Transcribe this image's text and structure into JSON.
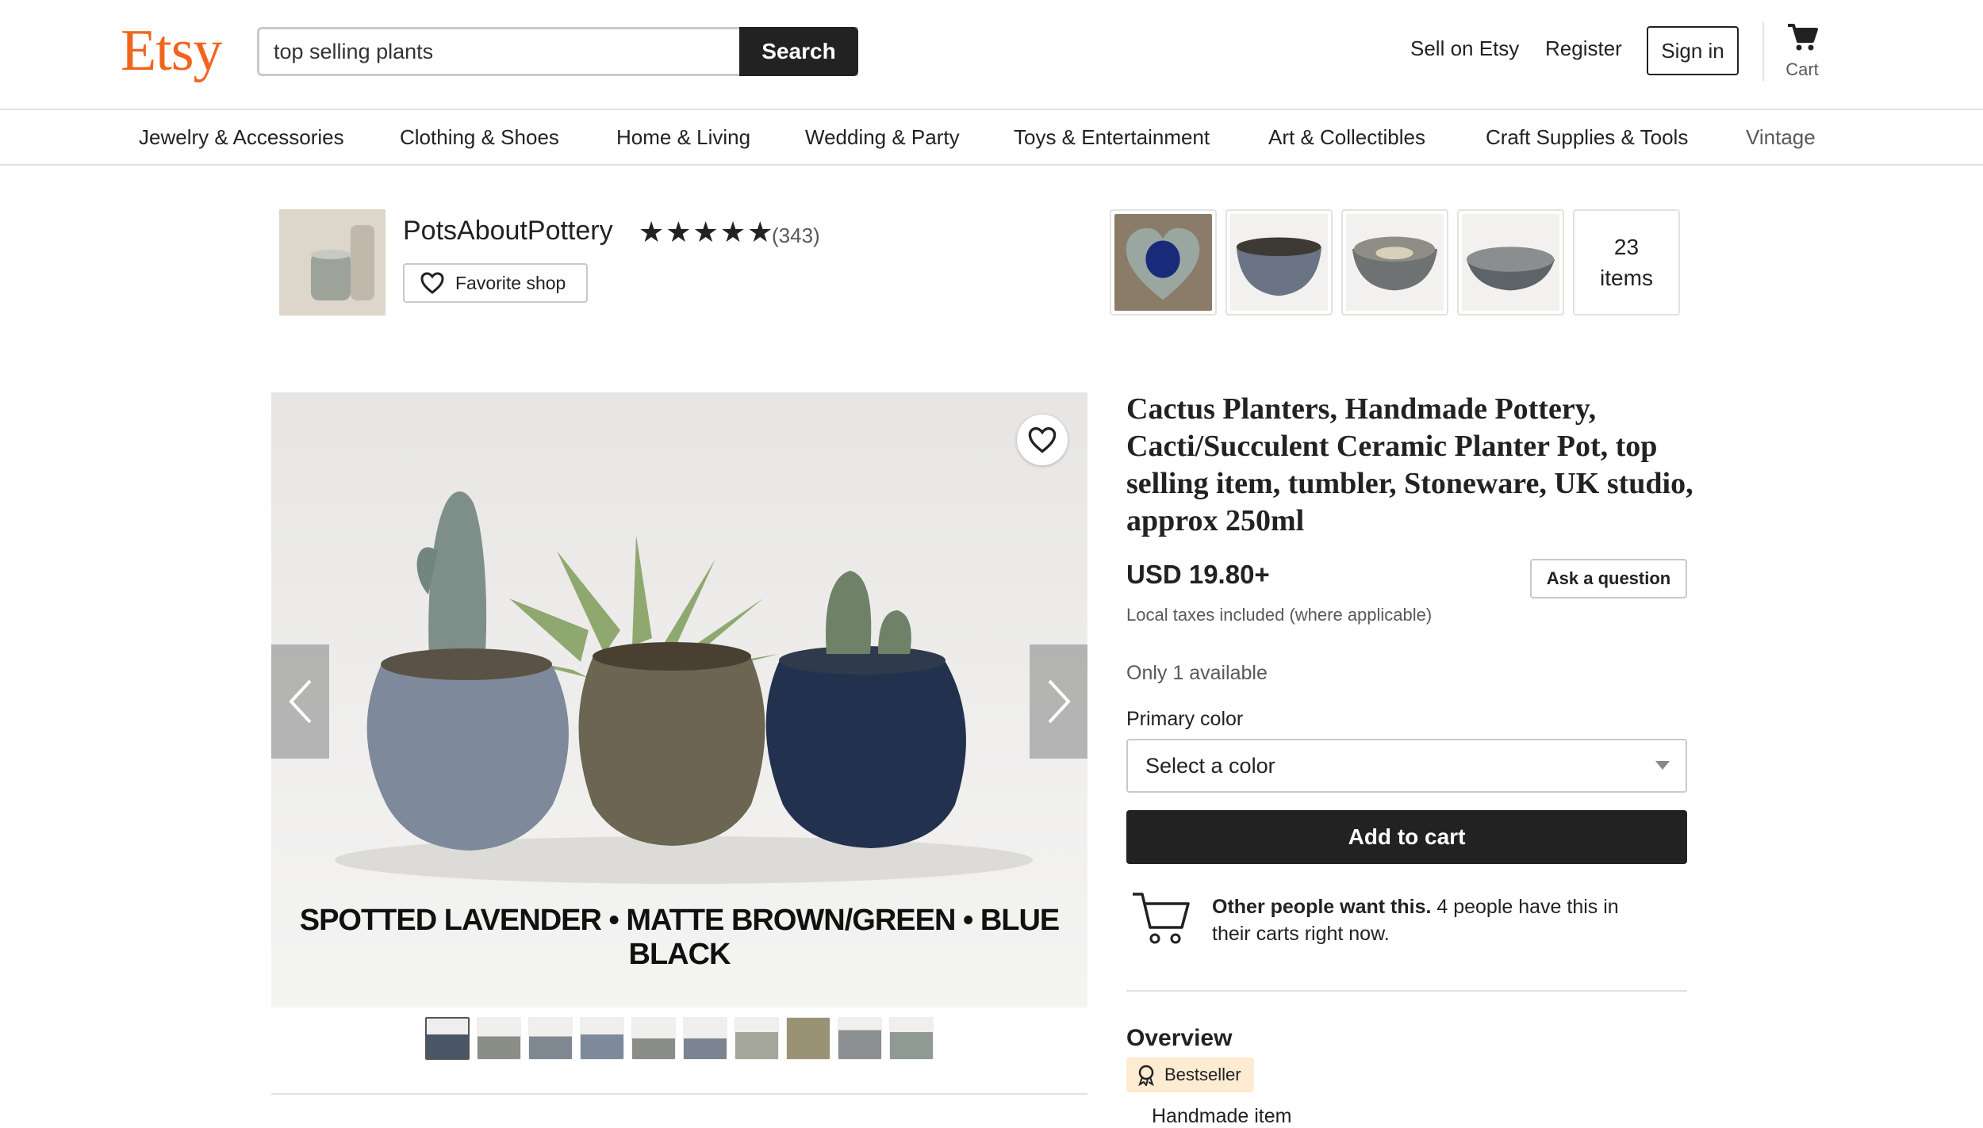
{
  "header": {
    "logo": "Etsy",
    "search_value": "top selling plants",
    "search_button": "Search",
    "sell": "Sell on Etsy",
    "register": "Register",
    "signin": "Sign in",
    "cart": "Cart"
  },
  "categories": [
    "Jewelry & Accessories",
    "Clothing & Shoes",
    "Home & Living",
    "Wedding & Party",
    "Toys & Entertainment",
    "Art & Collectibles",
    "Craft Supplies & Tools",
    "Vintage"
  ],
  "shop": {
    "name": "PotsAboutPottery",
    "stars": "★★★★★",
    "rating_count": "(343)",
    "favorite": "Favorite shop",
    "items_count": "23",
    "items_label": "items"
  },
  "listing": {
    "image_caption": "SPOTTED LAVENDER • MATTE BROWN/GREEN • BLUE BLACK",
    "title": "Cactus Planters, Handmade Pottery, Cacti/Succulent Ceramic Planter Pot, top selling item, tumbler, Stoneware, UK studio, approx 250ml",
    "price": "USD 19.80+",
    "ask": "Ask a question",
    "taxes": "Local taxes included (where applicable)",
    "availability": "Only 1 available",
    "primary_color_label": "Primary color",
    "select_placeholder": "Select a color",
    "add_to_cart": "Add to cart",
    "social_bold": "Other people want this.",
    "social_rest": " 4 people have this in their carts right now.",
    "overview": "Overview",
    "badge": "Bestseller",
    "handmade": "Handmade item"
  },
  "colors": {
    "brand": "#f1641e",
    "dark": "#222222",
    "badge_bg": "#fdebd2"
  }
}
